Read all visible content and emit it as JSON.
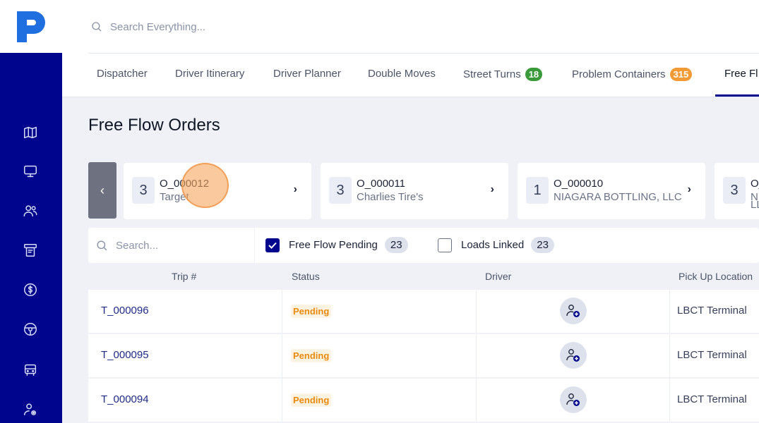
{
  "header": {
    "search_placeholder": "Search Everything..."
  },
  "sidebar": {
    "icons": [
      "map-icon",
      "monitor-icon",
      "users-icon",
      "board-icon",
      "dollar-icon",
      "steering-wheel-icon",
      "truck-icon",
      "user-settings-icon"
    ]
  },
  "tabs": [
    {
      "label": "Dispatcher"
    },
    {
      "label": "Driver Itinerary"
    },
    {
      "label": "Driver Planner"
    },
    {
      "label": "Double Moves"
    },
    {
      "label": "Street Turns",
      "badge": "18",
      "badge_color": "#3a9a3a"
    },
    {
      "label": "Problem Containers",
      "badge": "315",
      "badge_color": "#f29a36"
    },
    {
      "label": "Free Fl"
    }
  ],
  "page": {
    "title": "Free Flow Orders"
  },
  "orders": [
    {
      "count": "3",
      "id": "O_000012",
      "name": "Target"
    },
    {
      "count": "3",
      "id": "O_000011",
      "name": "Charlies Tire's"
    },
    {
      "count": "1",
      "id": "O_000010",
      "name": "NIAGARA BOTTLING, LLC"
    },
    {
      "count": "3",
      "id": "O_",
      "name": "NI",
      "name2": "LL"
    }
  ],
  "filters": {
    "search_placeholder": "Search...",
    "free_flow_pending": {
      "label": "Free Flow Pending",
      "count": "23",
      "checked": true
    },
    "loads_linked": {
      "label": "Loads Linked",
      "count": "23",
      "checked": false
    }
  },
  "table": {
    "columns": [
      "Trip #",
      "Status",
      "Driver",
      "Pick Up Location"
    ],
    "rows": [
      {
        "trip": "T_000096",
        "status": "Pending",
        "pickup": "LBCT Terminal"
      },
      {
        "trip": "T_000095",
        "status": "Pending",
        "pickup": "LBCT Terminal"
      },
      {
        "trip": "T_000094",
        "status": "Pending",
        "pickup": "LBCT Terminal"
      }
    ]
  },
  "colors": {
    "brand": "#00058d",
    "pending": "#e88a0b"
  }
}
